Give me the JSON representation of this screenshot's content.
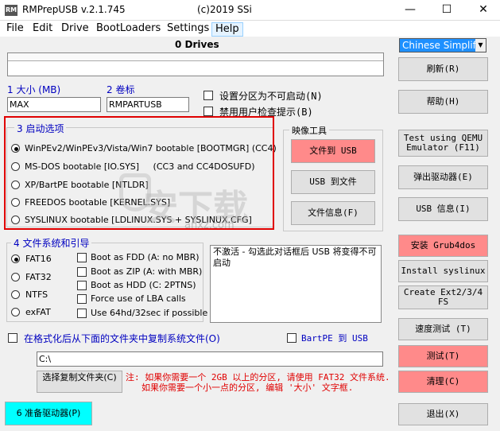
{
  "window": {
    "app_icon_text": "RM",
    "title": "RMPrepUSB v.2.1.745",
    "copyright": "(c)2019 SSi",
    "minimize": "—",
    "maximize": "☐",
    "close": "✕"
  },
  "menu": [
    "File",
    "Edit",
    "Drive",
    "BootLoaders",
    "Settings",
    "Help"
  ],
  "drives_label": "0 Drives",
  "language": "Chinese Simplified",
  "right_buttons": {
    "refresh": "刷新(R)",
    "help": "帮助(H)",
    "test_qemu": "Test using QEMU Emulator (F11)",
    "eject": "弹出驱动器(E)",
    "usb_info": "USB 信息(I)",
    "install_grub": "安装 Grub4dos",
    "install_syslinux": "Install syslinux",
    "create_ext": "Create Ext2/3/4 FS",
    "speed_test": "速度测试 (T)",
    "test": "测试(T)",
    "clean": "清理(C)",
    "exit": "退出(X)"
  },
  "size_label": "1 大小 (MB)",
  "size_value": "MAX",
  "volume_label": "2 卷标",
  "volume_value": "RMPARTUSB",
  "checkboxes_top": {
    "no_boot": "设置分区为不可启动(N)",
    "no_user_prompt": "禁用用户检查提示(B)"
  },
  "boot_options": {
    "legend": "3 启动选项",
    "items": [
      "WinPEv2/WinPEv3/Vista/Win7 bootable [BOOTMGR] (CC4)",
      "MS-DOS bootable [IO.SYS]     (CC3 and CC4DOSUFD)",
      "XP/BartPE bootable [NTLDR]",
      "FREEDOS bootable [KERNEL.SYS]",
      "SYSLINUX bootable [LDLINUX.SYS + SYSLINUX.CFG]"
    ]
  },
  "image_tools": {
    "legend": "映像工具",
    "file_to_usb": "文件到 USB",
    "usb_to_file": "USB 到文件",
    "file_info": "文件信息(F)"
  },
  "fs_boot": {
    "legend": "4 文件系统和引导",
    "filesystems": [
      "FAT16",
      "FAT32",
      "NTFS",
      "exFAT"
    ],
    "options": [
      "Boot as FDD (A: no MBR)",
      "Boot as ZIP (A: with MBR)",
      "Boot as HDD (C: 2PTNS)",
      "Force use of LBA calls",
      "Use 64hd/32sec if possible"
    ]
  },
  "info_text": "不激活 - 勾选此对话框后 USB 将变得不可启动",
  "copy_files_label": "在格式化后从下面的文件夹中复制系统文件(O)",
  "bartpe_label": "BartPE 到 USB",
  "path_value": "C:\\",
  "choose_folder": "选择复制文件夹(C)",
  "note_line1": "注: 如果你需要一个 2GB 以上的分区, 请使用 FAT32 文件系统.",
  "note_line2": "如果你需要一个小一点的分区, 编辑 '大小' 文字框.",
  "prepare_drive": "6 准备驱动器(P)",
  "watermark": "安下载",
  "watermark_sub": "anxz.com",
  "colors": {
    "red_box": "#e00000",
    "pink_button": "#ff8a8a",
    "cyan_button": "#00ffff",
    "lang_bg": "#1e90ff",
    "blue_label": "#0000c0"
  }
}
